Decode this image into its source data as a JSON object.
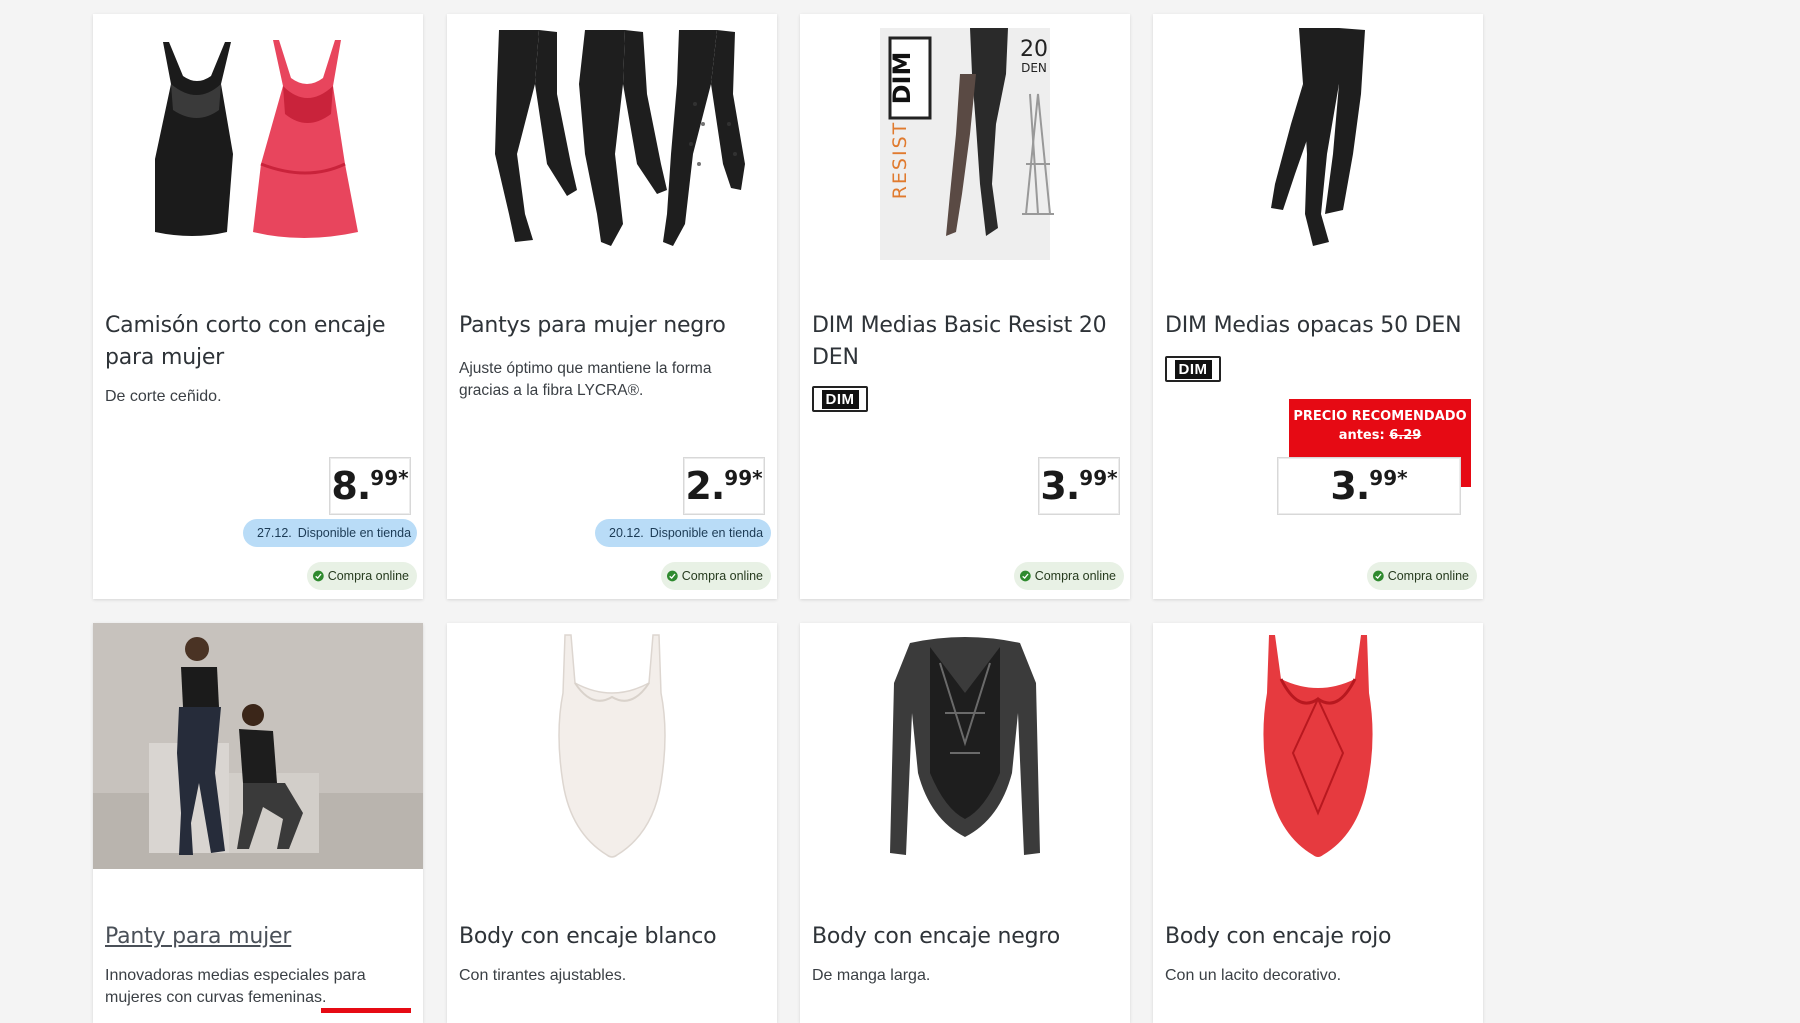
{
  "colors": {
    "page_bg": "#f4f4f4",
    "card_bg": "#ffffff",
    "accent_red": "#e60a14",
    "store_pill": "#b9dcf7",
    "online_pill": "#e8f1e5",
    "check_green": "#2f8a2f"
  },
  "products": [
    {
      "title": "Camisón corto con encaje para mujer",
      "description": "De corte ceñido.",
      "price_int": "8.",
      "price_dec": "99*",
      "store": {
        "date": "27.12.",
        "label": "Disponible en tienda",
        "icon": "location-pin-icon"
      },
      "online": {
        "label": "Compra online",
        "icon": "check-circle-icon"
      }
    },
    {
      "title": "Pantys para mujer negro",
      "description": "Ajuste óptimo que mantiene la forma gracias a la fibra LYCRA®.",
      "price_int": "2.",
      "price_dec": "99*",
      "store": {
        "date": "20.12.",
        "label": "Disponible en tienda",
        "icon": "location-pin-icon"
      },
      "online": {
        "label": "Compra online",
        "icon": "check-circle-icon"
      }
    },
    {
      "title": "DIM Medias Basic Resist 20 DEN",
      "brand": "DIM",
      "image_text": {
        "brand": "DIM",
        "den": "20",
        "den_unit": "DEN",
        "line": "RESIST"
      },
      "price_int": "3.",
      "price_dec": "99*",
      "online": {
        "label": "Compra online",
        "icon": "check-circle-icon"
      }
    },
    {
      "title": "DIM Medias opacas 50 DEN",
      "brand": "DIM",
      "recommended": {
        "label": "PRECIO RECOMENDADO",
        "before_label": "antes:",
        "before_price": "6.29"
      },
      "price_int": "3.",
      "price_dec": "99*",
      "online": {
        "label": "Compra online",
        "icon": "check-circle-icon"
      }
    },
    {
      "title": "Panty para mujer",
      "description": "Innovadoras medias especiales para mujeres con curvas femeninas."
    },
    {
      "title": "Body con encaje blanco",
      "description": "Con tirantes ajustables."
    },
    {
      "title": "Body con encaje negro",
      "description": "De manga larga."
    },
    {
      "title": "Body con encaje rojo",
      "description": "Con un lacito decorativo."
    }
  ]
}
